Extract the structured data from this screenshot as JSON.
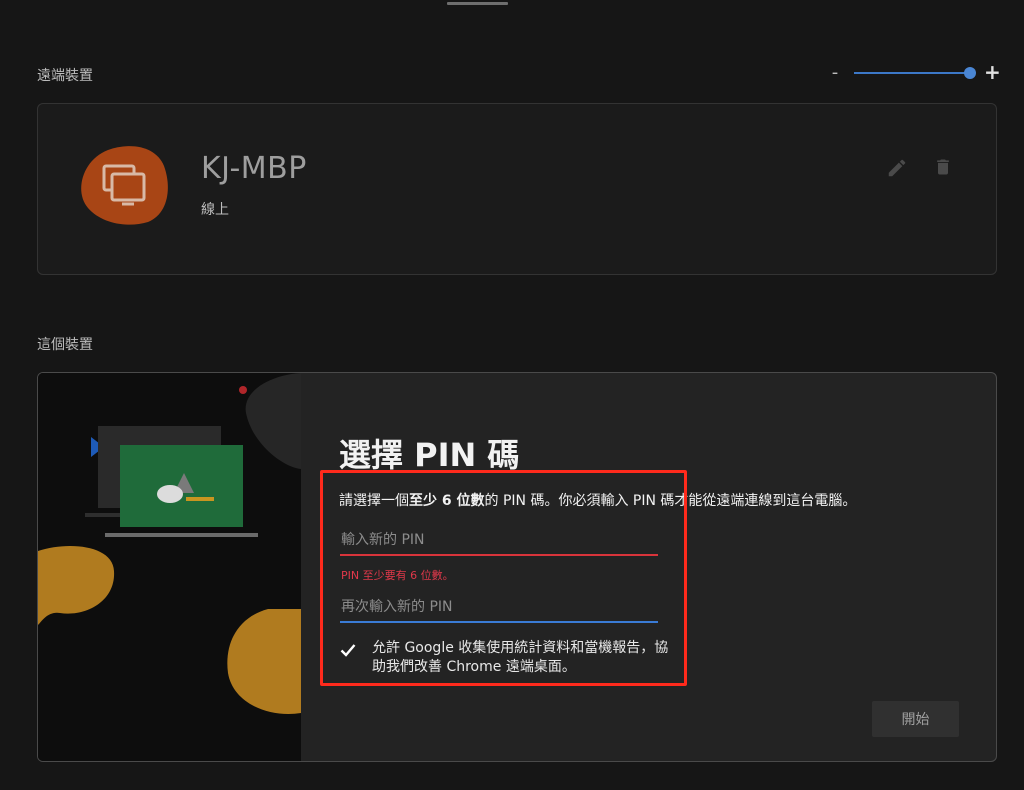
{
  "sections": {
    "remote_title": "遠端裝置",
    "this_title": "這個裝置"
  },
  "zoom": {
    "minus_label": "-",
    "plus_label": "+",
    "level": 1.0
  },
  "remote_device": {
    "name": "KJ-MBP",
    "status": "線上",
    "icon": "monitor-icon",
    "accent_color": "#a84515"
  },
  "pin_setup": {
    "title": "選擇 PIN 碼",
    "desc_prefix": "請選擇一個",
    "desc_bold": "至少 6 位數",
    "desc_suffix": "的 PIN 碼。你必須輸入 PIN 碼才能從遠端連線到這台電腦。",
    "new_pin": {
      "value": "",
      "placeholder": "輸入新的 PIN"
    },
    "error_text": "PIN 至少要有 6 位數。",
    "confirm_pin": {
      "value": "",
      "placeholder": "再次輸入新的 PIN"
    },
    "consent_checked": true,
    "consent_text": "允許 Google 收集使用統計資料和當機報告，協助我們改善 Chrome 遠端桌面。",
    "start_label": "開始"
  },
  "colors": {
    "error": "#d9343b",
    "focus": "#3a7bd5",
    "illustration_orange": "#b07b1f",
    "illustration_green": "#1f6b3a"
  }
}
